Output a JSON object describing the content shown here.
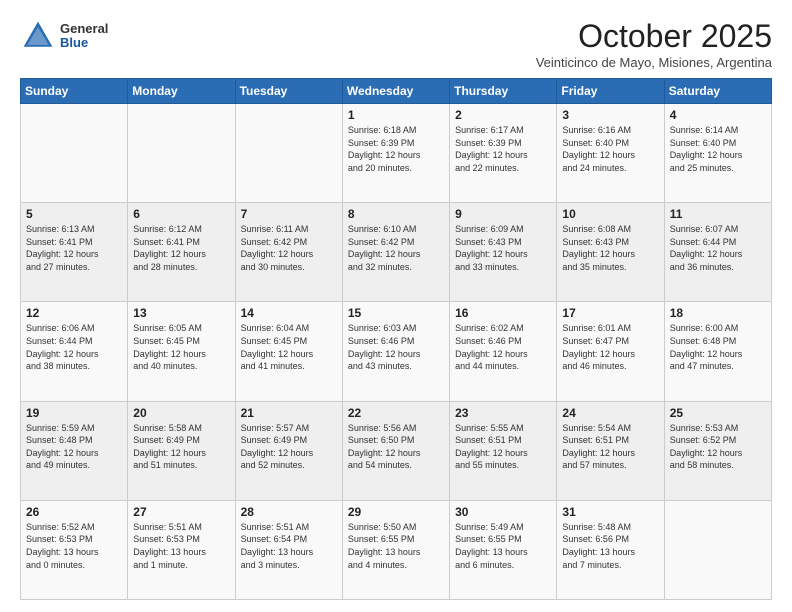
{
  "header": {
    "logo_general": "General",
    "logo_blue": "Blue",
    "month_title": "October 2025",
    "location": "Veinticinco de Mayo, Misiones, Argentina"
  },
  "weekdays": [
    "Sunday",
    "Monday",
    "Tuesday",
    "Wednesday",
    "Thursday",
    "Friday",
    "Saturday"
  ],
  "weeks": [
    [
      {
        "day": "",
        "text": ""
      },
      {
        "day": "",
        "text": ""
      },
      {
        "day": "",
        "text": ""
      },
      {
        "day": "1",
        "text": "Sunrise: 6:18 AM\nSunset: 6:39 PM\nDaylight: 12 hours\nand 20 minutes."
      },
      {
        "day": "2",
        "text": "Sunrise: 6:17 AM\nSunset: 6:39 PM\nDaylight: 12 hours\nand 22 minutes."
      },
      {
        "day": "3",
        "text": "Sunrise: 6:16 AM\nSunset: 6:40 PM\nDaylight: 12 hours\nand 24 minutes."
      },
      {
        "day": "4",
        "text": "Sunrise: 6:14 AM\nSunset: 6:40 PM\nDaylight: 12 hours\nand 25 minutes."
      }
    ],
    [
      {
        "day": "5",
        "text": "Sunrise: 6:13 AM\nSunset: 6:41 PM\nDaylight: 12 hours\nand 27 minutes."
      },
      {
        "day": "6",
        "text": "Sunrise: 6:12 AM\nSunset: 6:41 PM\nDaylight: 12 hours\nand 28 minutes."
      },
      {
        "day": "7",
        "text": "Sunrise: 6:11 AM\nSunset: 6:42 PM\nDaylight: 12 hours\nand 30 minutes."
      },
      {
        "day": "8",
        "text": "Sunrise: 6:10 AM\nSunset: 6:42 PM\nDaylight: 12 hours\nand 32 minutes."
      },
      {
        "day": "9",
        "text": "Sunrise: 6:09 AM\nSunset: 6:43 PM\nDaylight: 12 hours\nand 33 minutes."
      },
      {
        "day": "10",
        "text": "Sunrise: 6:08 AM\nSunset: 6:43 PM\nDaylight: 12 hours\nand 35 minutes."
      },
      {
        "day": "11",
        "text": "Sunrise: 6:07 AM\nSunset: 6:44 PM\nDaylight: 12 hours\nand 36 minutes."
      }
    ],
    [
      {
        "day": "12",
        "text": "Sunrise: 6:06 AM\nSunset: 6:44 PM\nDaylight: 12 hours\nand 38 minutes."
      },
      {
        "day": "13",
        "text": "Sunrise: 6:05 AM\nSunset: 6:45 PM\nDaylight: 12 hours\nand 40 minutes."
      },
      {
        "day": "14",
        "text": "Sunrise: 6:04 AM\nSunset: 6:45 PM\nDaylight: 12 hours\nand 41 minutes."
      },
      {
        "day": "15",
        "text": "Sunrise: 6:03 AM\nSunset: 6:46 PM\nDaylight: 12 hours\nand 43 minutes."
      },
      {
        "day": "16",
        "text": "Sunrise: 6:02 AM\nSunset: 6:46 PM\nDaylight: 12 hours\nand 44 minutes."
      },
      {
        "day": "17",
        "text": "Sunrise: 6:01 AM\nSunset: 6:47 PM\nDaylight: 12 hours\nand 46 minutes."
      },
      {
        "day": "18",
        "text": "Sunrise: 6:00 AM\nSunset: 6:48 PM\nDaylight: 12 hours\nand 47 minutes."
      }
    ],
    [
      {
        "day": "19",
        "text": "Sunrise: 5:59 AM\nSunset: 6:48 PM\nDaylight: 12 hours\nand 49 minutes."
      },
      {
        "day": "20",
        "text": "Sunrise: 5:58 AM\nSunset: 6:49 PM\nDaylight: 12 hours\nand 51 minutes."
      },
      {
        "day": "21",
        "text": "Sunrise: 5:57 AM\nSunset: 6:49 PM\nDaylight: 12 hours\nand 52 minutes."
      },
      {
        "day": "22",
        "text": "Sunrise: 5:56 AM\nSunset: 6:50 PM\nDaylight: 12 hours\nand 54 minutes."
      },
      {
        "day": "23",
        "text": "Sunrise: 5:55 AM\nSunset: 6:51 PM\nDaylight: 12 hours\nand 55 minutes."
      },
      {
        "day": "24",
        "text": "Sunrise: 5:54 AM\nSunset: 6:51 PM\nDaylight: 12 hours\nand 57 minutes."
      },
      {
        "day": "25",
        "text": "Sunrise: 5:53 AM\nSunset: 6:52 PM\nDaylight: 12 hours\nand 58 minutes."
      }
    ],
    [
      {
        "day": "26",
        "text": "Sunrise: 5:52 AM\nSunset: 6:53 PM\nDaylight: 13 hours\nand 0 minutes."
      },
      {
        "day": "27",
        "text": "Sunrise: 5:51 AM\nSunset: 6:53 PM\nDaylight: 13 hours\nand 1 minute."
      },
      {
        "day": "28",
        "text": "Sunrise: 5:51 AM\nSunset: 6:54 PM\nDaylight: 13 hours\nand 3 minutes."
      },
      {
        "day": "29",
        "text": "Sunrise: 5:50 AM\nSunset: 6:55 PM\nDaylight: 13 hours\nand 4 minutes."
      },
      {
        "day": "30",
        "text": "Sunrise: 5:49 AM\nSunset: 6:55 PM\nDaylight: 13 hours\nand 6 minutes."
      },
      {
        "day": "31",
        "text": "Sunrise: 5:48 AM\nSunset: 6:56 PM\nDaylight: 13 hours\nand 7 minutes."
      },
      {
        "day": "",
        "text": ""
      }
    ]
  ]
}
